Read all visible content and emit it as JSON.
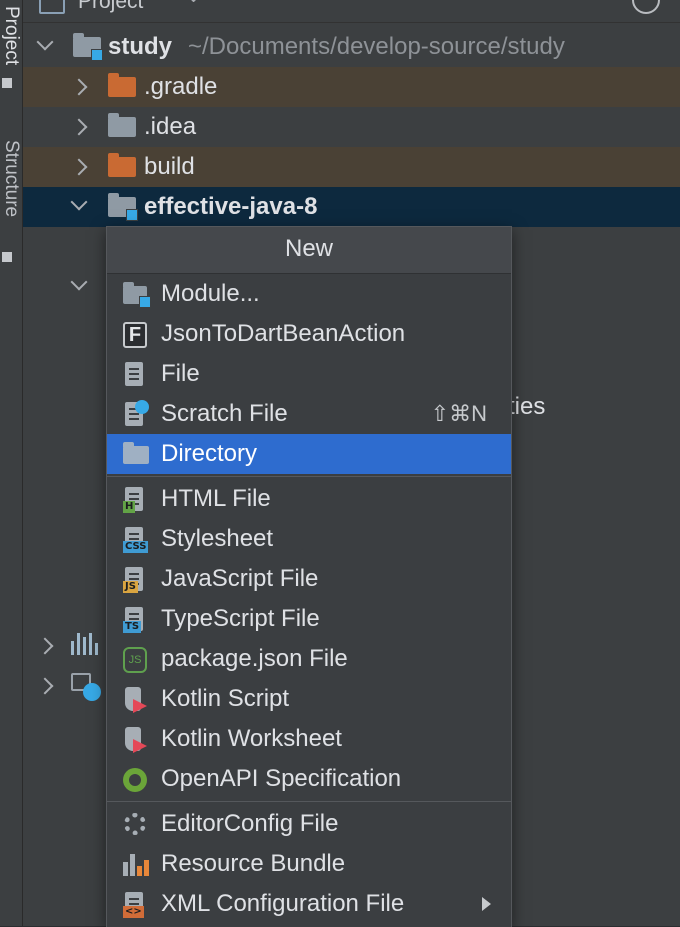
{
  "sidebar": {
    "project_label": "Project",
    "structure_label": "Structure"
  },
  "header": {
    "title": "Project",
    "caret": "⌄"
  },
  "tree": {
    "root": {
      "name": "study",
      "path": "~/Documents/develop-source/study"
    },
    "items": [
      {
        "label": ".gradle",
        "excluded": true
      },
      {
        "label": ".idea",
        "excluded": false
      },
      {
        "label": "build",
        "excluded": true
      },
      {
        "label": "effective-java-8",
        "selected": true
      }
    ],
    "obscured_text": "ties"
  },
  "menu": {
    "title": "New",
    "items": [
      {
        "label": "Module...",
        "icon": "module-icon"
      },
      {
        "label": "JsonToDartBeanAction",
        "icon": "f-plugin-icon",
        "glyph": "F"
      },
      {
        "label": "File",
        "icon": "file-icon"
      },
      {
        "label": "Scratch File",
        "icon": "scratch-file-icon",
        "shortcut": "⇧⌘N"
      },
      {
        "label": "Directory",
        "icon": "folder-icon",
        "active": true
      },
      {
        "label": "HTML File",
        "icon": "html-file-icon",
        "tag": "H"
      },
      {
        "label": "Stylesheet",
        "icon": "css-file-icon",
        "tag": "CSS"
      },
      {
        "label": "JavaScript File",
        "icon": "js-file-icon",
        "tag": "JS"
      },
      {
        "label": "TypeScript File",
        "icon": "ts-file-icon",
        "tag": "TS"
      },
      {
        "label": "package.json File",
        "icon": "nodejs-icon",
        "glyph": "JS"
      },
      {
        "label": "Kotlin Script",
        "icon": "kotlin-script-icon"
      },
      {
        "label": "Kotlin Worksheet",
        "icon": "kotlin-worksheet-icon"
      },
      {
        "label": "OpenAPI Specification",
        "icon": "openapi-icon"
      },
      {
        "label": "EditorConfig File",
        "icon": "gear-icon"
      },
      {
        "label": "Resource Bundle",
        "icon": "resource-bundle-icon"
      },
      {
        "label": "XML Configuration File",
        "icon": "xml-file-icon",
        "tag": "<>",
        "submenu": true
      }
    ]
  },
  "colors": {
    "panel_bg": "#3c3f41",
    "excluded_row": "#4a4135",
    "selected_row": "#0d293e",
    "menu_active": "#2e6ccf",
    "module_badge": "#37a9e6",
    "excluded_folder": "#c96a33"
  }
}
